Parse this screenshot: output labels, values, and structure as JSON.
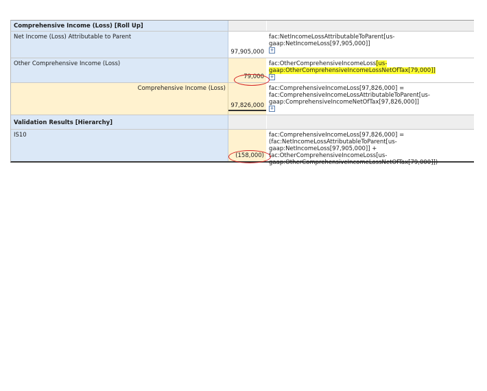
{
  "table": {
    "section_rollup": "Comprehensive Income (Loss) [Roll Up]",
    "rows": [
      {
        "label": "Net Income (Loss) Attributable to Parent",
        "value": "97,905,000",
        "formula": "fac:NetIncomeLossAttributableToParent[us-gaap:NetIncomeLoss[97,905,000]]"
      },
      {
        "label": "Other Comprehensive Income (Loss)",
        "value": "79,000",
        "formula_pre": "fac:OtherComprehensiveIncomeLoss",
        "formula_hl": "[us-gaap:OtherComprehensiveIncomeLossNetOfTax[79,000]]"
      },
      {
        "label": "Comprehensive Income (Loss)",
        "value": "97,826,000",
        "formula": "fac:ComprehensiveIncomeLoss[97,826,000] = fac:ComprehensiveIncomeLossAttributableToParent[us-gaap:ComprehensiveIncomeNetOfTax[97,826,000]]"
      }
    ],
    "section_validation": "Validation Results [Hierarchy]",
    "validation_row": {
      "label": "IS10",
      "value": "(158,000)",
      "formula": "fac:ComprehensiveIncomeLoss[97,826,000] = (fac:NetIncomeLossAttributableToParent[us-gaap:NetIncomeLoss[97,905,000]] + fac:OtherComprehensiveIncomeLoss[us-gaap:OtherComprehensiveIncomeLossNetOfTax[79,000]])"
    },
    "expand_icon": "+",
    "colors": {
      "label_bg": "#dbe8f7",
      "value_bg": "#fff2cf",
      "highlight": "#ffff33",
      "annotation_ring": "#d42020"
    }
  }
}
